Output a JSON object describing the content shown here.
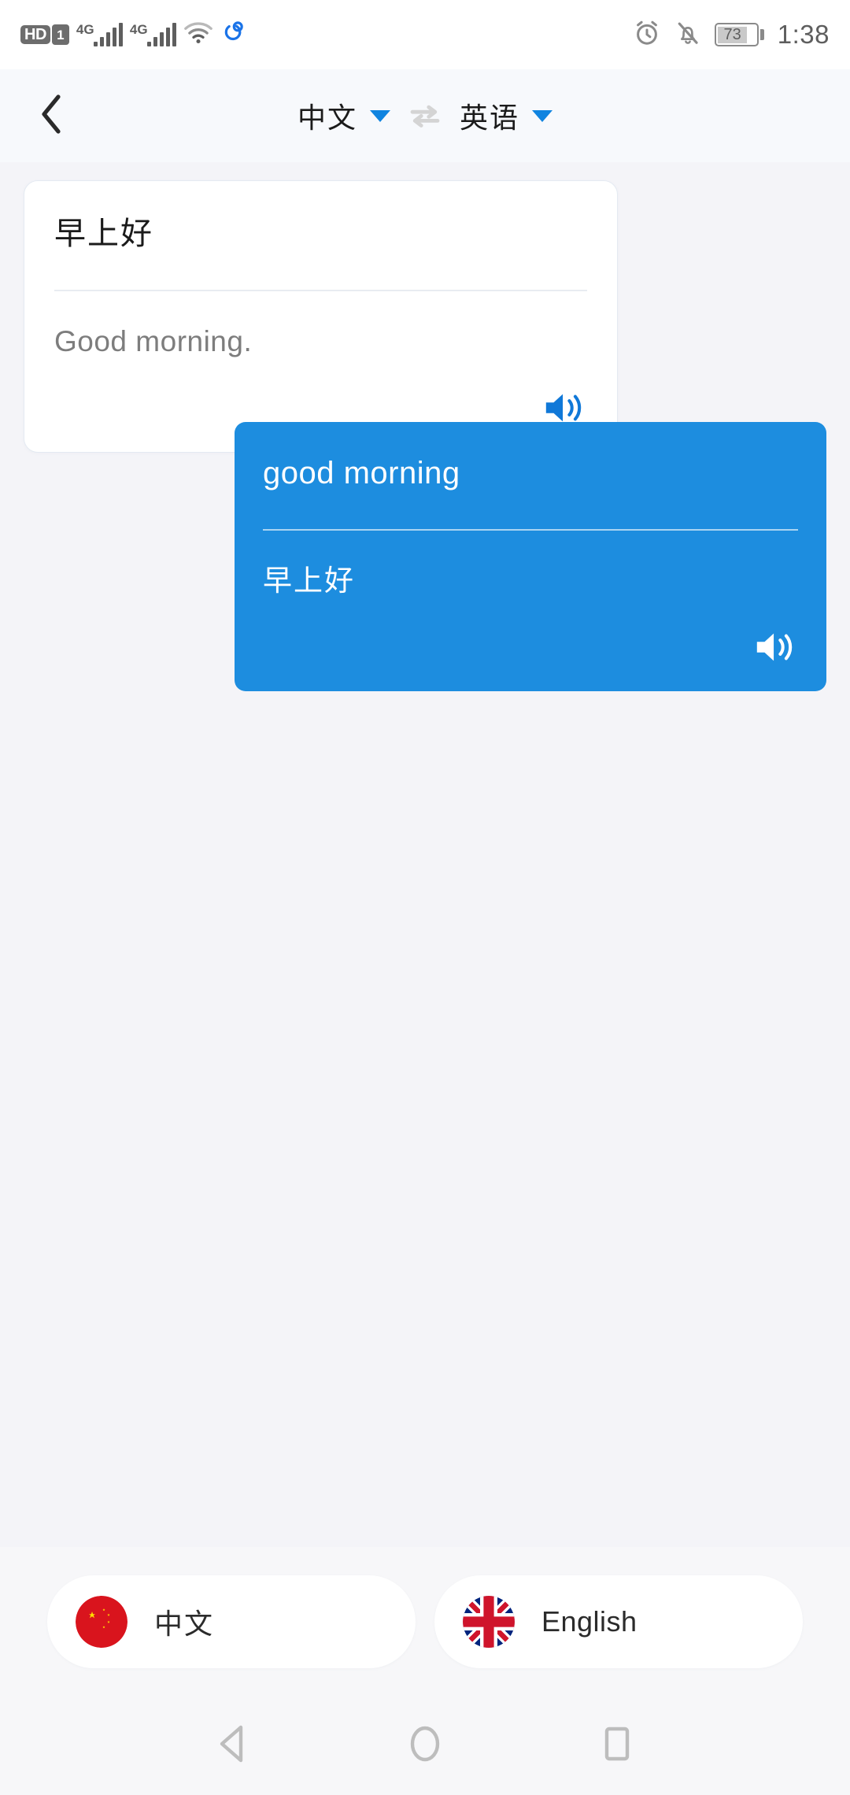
{
  "status_bar": {
    "volte_label": "HD",
    "sim_label": "1",
    "network_1": "4G",
    "network_2": "4G",
    "wifi_icon": "wifi-icon",
    "sync_icon": "sync-icon",
    "alarm_icon": "alarm-clock-icon",
    "notifications_muted_icon": "bell-muted-icon",
    "battery_percent": "73",
    "time": "1:38"
  },
  "header": {
    "back_icon": "chevron-left-icon",
    "source_language": "中文",
    "target_language": "英语",
    "swap_icon": "swap-horizontal-icon",
    "dropdown_icon": "caret-down-icon"
  },
  "cards": [
    {
      "side": "left",
      "source_text": "早上好",
      "translated_text": "Good morning.",
      "speaker_icon": "speaker-icon"
    },
    {
      "side": "right",
      "source_text": "good morning",
      "translated_text": "早上好",
      "speaker_icon": "speaker-icon"
    }
  ],
  "bottom_bar": {
    "buttons": [
      {
        "label": "中文",
        "flag": "flag-china-icon"
      },
      {
        "label": "English",
        "flag": "flag-uk-icon"
      }
    ]
  },
  "nav_bar": {
    "back": "nav-back-icon",
    "home": "nav-home-icon",
    "recents": "nav-recents-icon"
  },
  "colors": {
    "accent_blue": "#1d8ddf",
    "page_background": "#f4f4f8",
    "header_background": "#f7f9fc",
    "card_white": "#ffffff",
    "muted_text": "#7d7d7d"
  }
}
